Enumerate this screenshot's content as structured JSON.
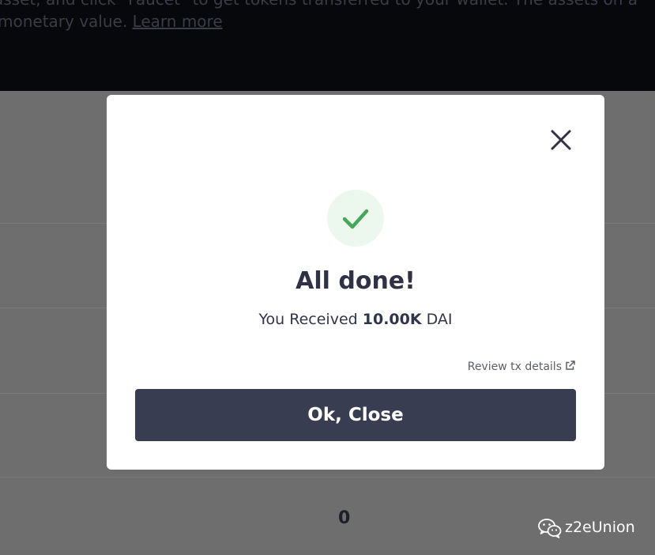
{
  "banner": {
    "line1": "asset, and click \"Faucet\" to get tokens transferred to your wallet. The assets on a",
    "line2_text": "monetary value.",
    "learn_more": "Learn more"
  },
  "table": {
    "bottom_value": "0"
  },
  "modal": {
    "close_icon": "close-icon",
    "success_icon": "check-icon",
    "title": "All done!",
    "received_prefix": "You Received",
    "received_amount": "10.00K",
    "received_token": "DAI",
    "review_link": "Review tx details",
    "review_icon": "external-link-icon",
    "ok_button": "Ok, Close"
  },
  "watermark": {
    "icon": "wechat-icon",
    "text": "z2eUnion"
  },
  "colors": {
    "banner_bg": "#07080c",
    "overlay_bg": "#6e6e6e",
    "modal_bg": "#ffffff",
    "button_bg": "#383d51",
    "success_green": "#46a758",
    "success_circle_bg": "#ecf7ee",
    "title_text": "#2f3245"
  }
}
